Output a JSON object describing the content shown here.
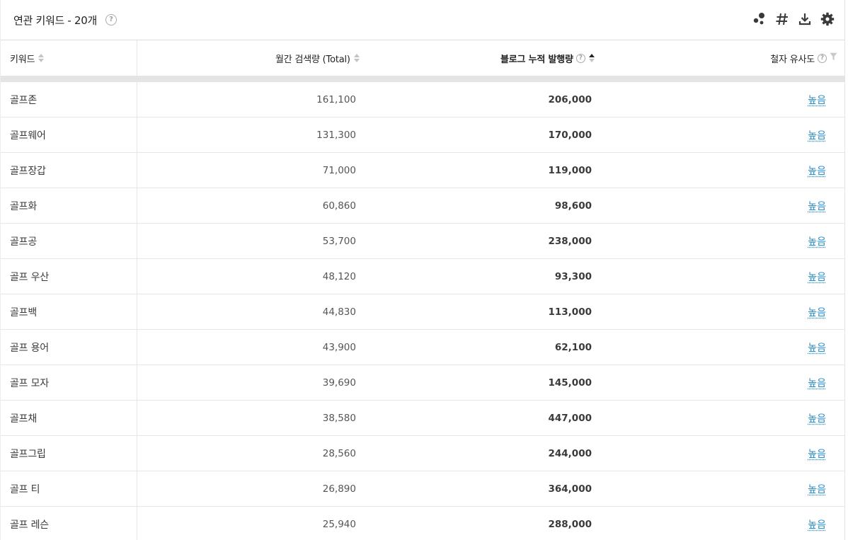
{
  "header": {
    "title": "연관 키워드 - 20개",
    "help_glyph": "?",
    "tools": [
      {
        "name": "bubble-chart-icon"
      },
      {
        "name": "hashtag-icon"
      },
      {
        "name": "download-icon"
      },
      {
        "name": "gear-icon"
      }
    ]
  },
  "table": {
    "columns": {
      "keyword": "키워드",
      "monthly_search": "월간 검색량 (Total)",
      "blog_posts": "블로그 누적 발행량",
      "similarity": "철자 유사도"
    },
    "sorted_column": "blog_posts",
    "rows": [
      {
        "keyword": "골프존",
        "monthly_search": "161,100",
        "blog_posts": "206,000",
        "similarity": "높음"
      },
      {
        "keyword": "골프웨어",
        "monthly_search": "131,300",
        "blog_posts": "170,000",
        "similarity": "높음"
      },
      {
        "keyword": "골프장갑",
        "monthly_search": "71,000",
        "blog_posts": "119,000",
        "similarity": "높음"
      },
      {
        "keyword": "골프화",
        "monthly_search": "60,860",
        "blog_posts": "98,600",
        "similarity": "높음"
      },
      {
        "keyword": "골프공",
        "monthly_search": "53,700",
        "blog_posts": "238,000",
        "similarity": "높음"
      },
      {
        "keyword": "골프 우산",
        "monthly_search": "48,120",
        "blog_posts": "93,300",
        "similarity": "높음"
      },
      {
        "keyword": "골프백",
        "monthly_search": "44,830",
        "blog_posts": "113,000",
        "similarity": "높음"
      },
      {
        "keyword": "골프 용어",
        "monthly_search": "43,900",
        "blog_posts": "62,100",
        "similarity": "높음"
      },
      {
        "keyword": "골프 모자",
        "monthly_search": "39,690",
        "blog_posts": "145,000",
        "similarity": "높음"
      },
      {
        "keyword": "골프채",
        "monthly_search": "38,580",
        "blog_posts": "447,000",
        "similarity": "높음"
      },
      {
        "keyword": "골프그립",
        "monthly_search": "28,560",
        "blog_posts": "244,000",
        "similarity": "높음"
      },
      {
        "keyword": "골프 티",
        "monthly_search": "26,890",
        "blog_posts": "364,000",
        "similarity": "높음"
      },
      {
        "keyword": "골프 레슨",
        "monthly_search": "25,940",
        "blog_posts": "288,000",
        "similarity": "높음"
      }
    ]
  }
}
